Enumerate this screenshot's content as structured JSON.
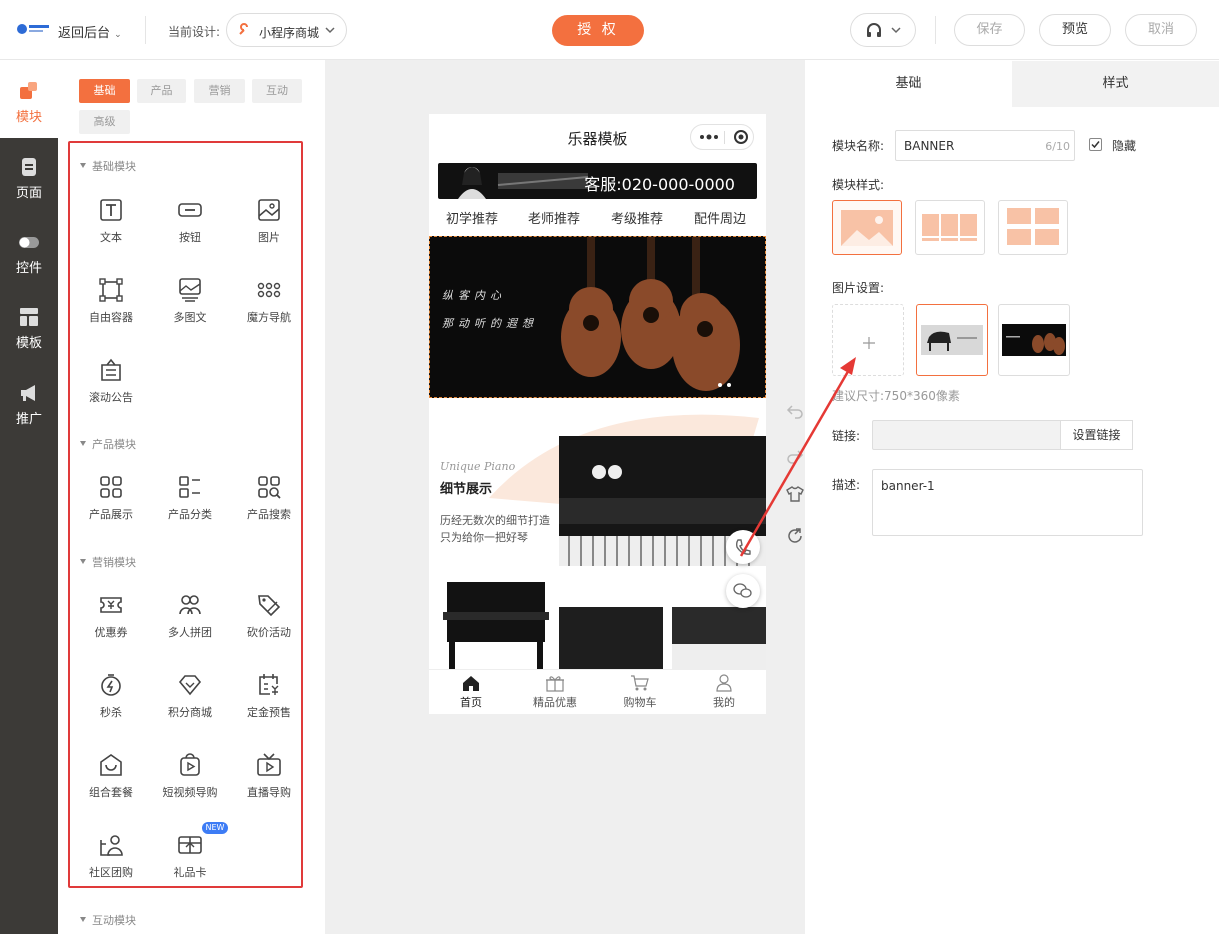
{
  "header": {
    "back_label": "返回后台",
    "current_design_label": "当前设计:",
    "design_name": "小程序商城",
    "authorize_label": "授 权",
    "save_label": "保存",
    "preview_label": "预览",
    "cancel_label": "取消"
  },
  "left_nav": {
    "items": [
      {
        "label": "模块",
        "icon": "modules-icon"
      },
      {
        "label": "页面",
        "icon": "page-icon"
      },
      {
        "label": "控件",
        "icon": "toggle-icon"
      },
      {
        "label": "模板",
        "icon": "template-icon"
      },
      {
        "label": "推广",
        "icon": "megaphone-icon"
      }
    ]
  },
  "library": {
    "tabs": [
      "基础",
      "产品",
      "营销",
      "互动",
      "高级"
    ],
    "sections": [
      {
        "title": "基础模块",
        "items": [
          "文本",
          "按钮",
          "图片",
          "自由容器",
          "多图文",
          "魔方导航",
          "滚动公告"
        ]
      },
      {
        "title": "产品模块",
        "items": [
          "产品展示",
          "产品分类",
          "产品搜索"
        ]
      },
      {
        "title": "营销模块",
        "items": [
          "优惠券",
          "多人拼团",
          "砍价活动",
          "秒杀",
          "积分商城",
          "定金预售",
          "组合套餐",
          "短视频导购",
          "直播导购",
          "社区团购",
          "礼品卡"
        ]
      },
      {
        "title": "互动模块",
        "items": []
      }
    ],
    "new_badge": "NEW"
  },
  "phone": {
    "title": "乐器模板",
    "service_text": "客服:020-000-0000",
    "categories": [
      "初学推荐",
      "老师推荐",
      "考级推荐",
      "配件周边"
    ],
    "banner_line1": "纵客内心",
    "banner_line2": "那动听的遐想",
    "detail_script": "Unique Piano",
    "detail_title": "细节展示",
    "detail_desc": "历经无数次的细节打造只为给你一把好琴",
    "tabbar": [
      "首页",
      "精品优惠",
      "购物车",
      "我的"
    ]
  },
  "props": {
    "tabs": [
      "基础",
      "样式"
    ],
    "module_name_label": "模块名称:",
    "module_name_value": "BANNER",
    "module_name_count": "6/10",
    "hide_label": "隐藏",
    "module_style_label": "模块样式:",
    "image_settings_label": "图片设置:",
    "size_hint": "建议尺寸:750*360像素",
    "link_label": "链接:",
    "link_button": "设置链接",
    "desc_label": "描述:",
    "desc_value": "banner-1"
  },
  "colors": {
    "accent": "#f3703f",
    "dark_nav": "#3c3a37",
    "highlight_box": "#e03a3a",
    "new_badge": "#3d7cf5"
  }
}
